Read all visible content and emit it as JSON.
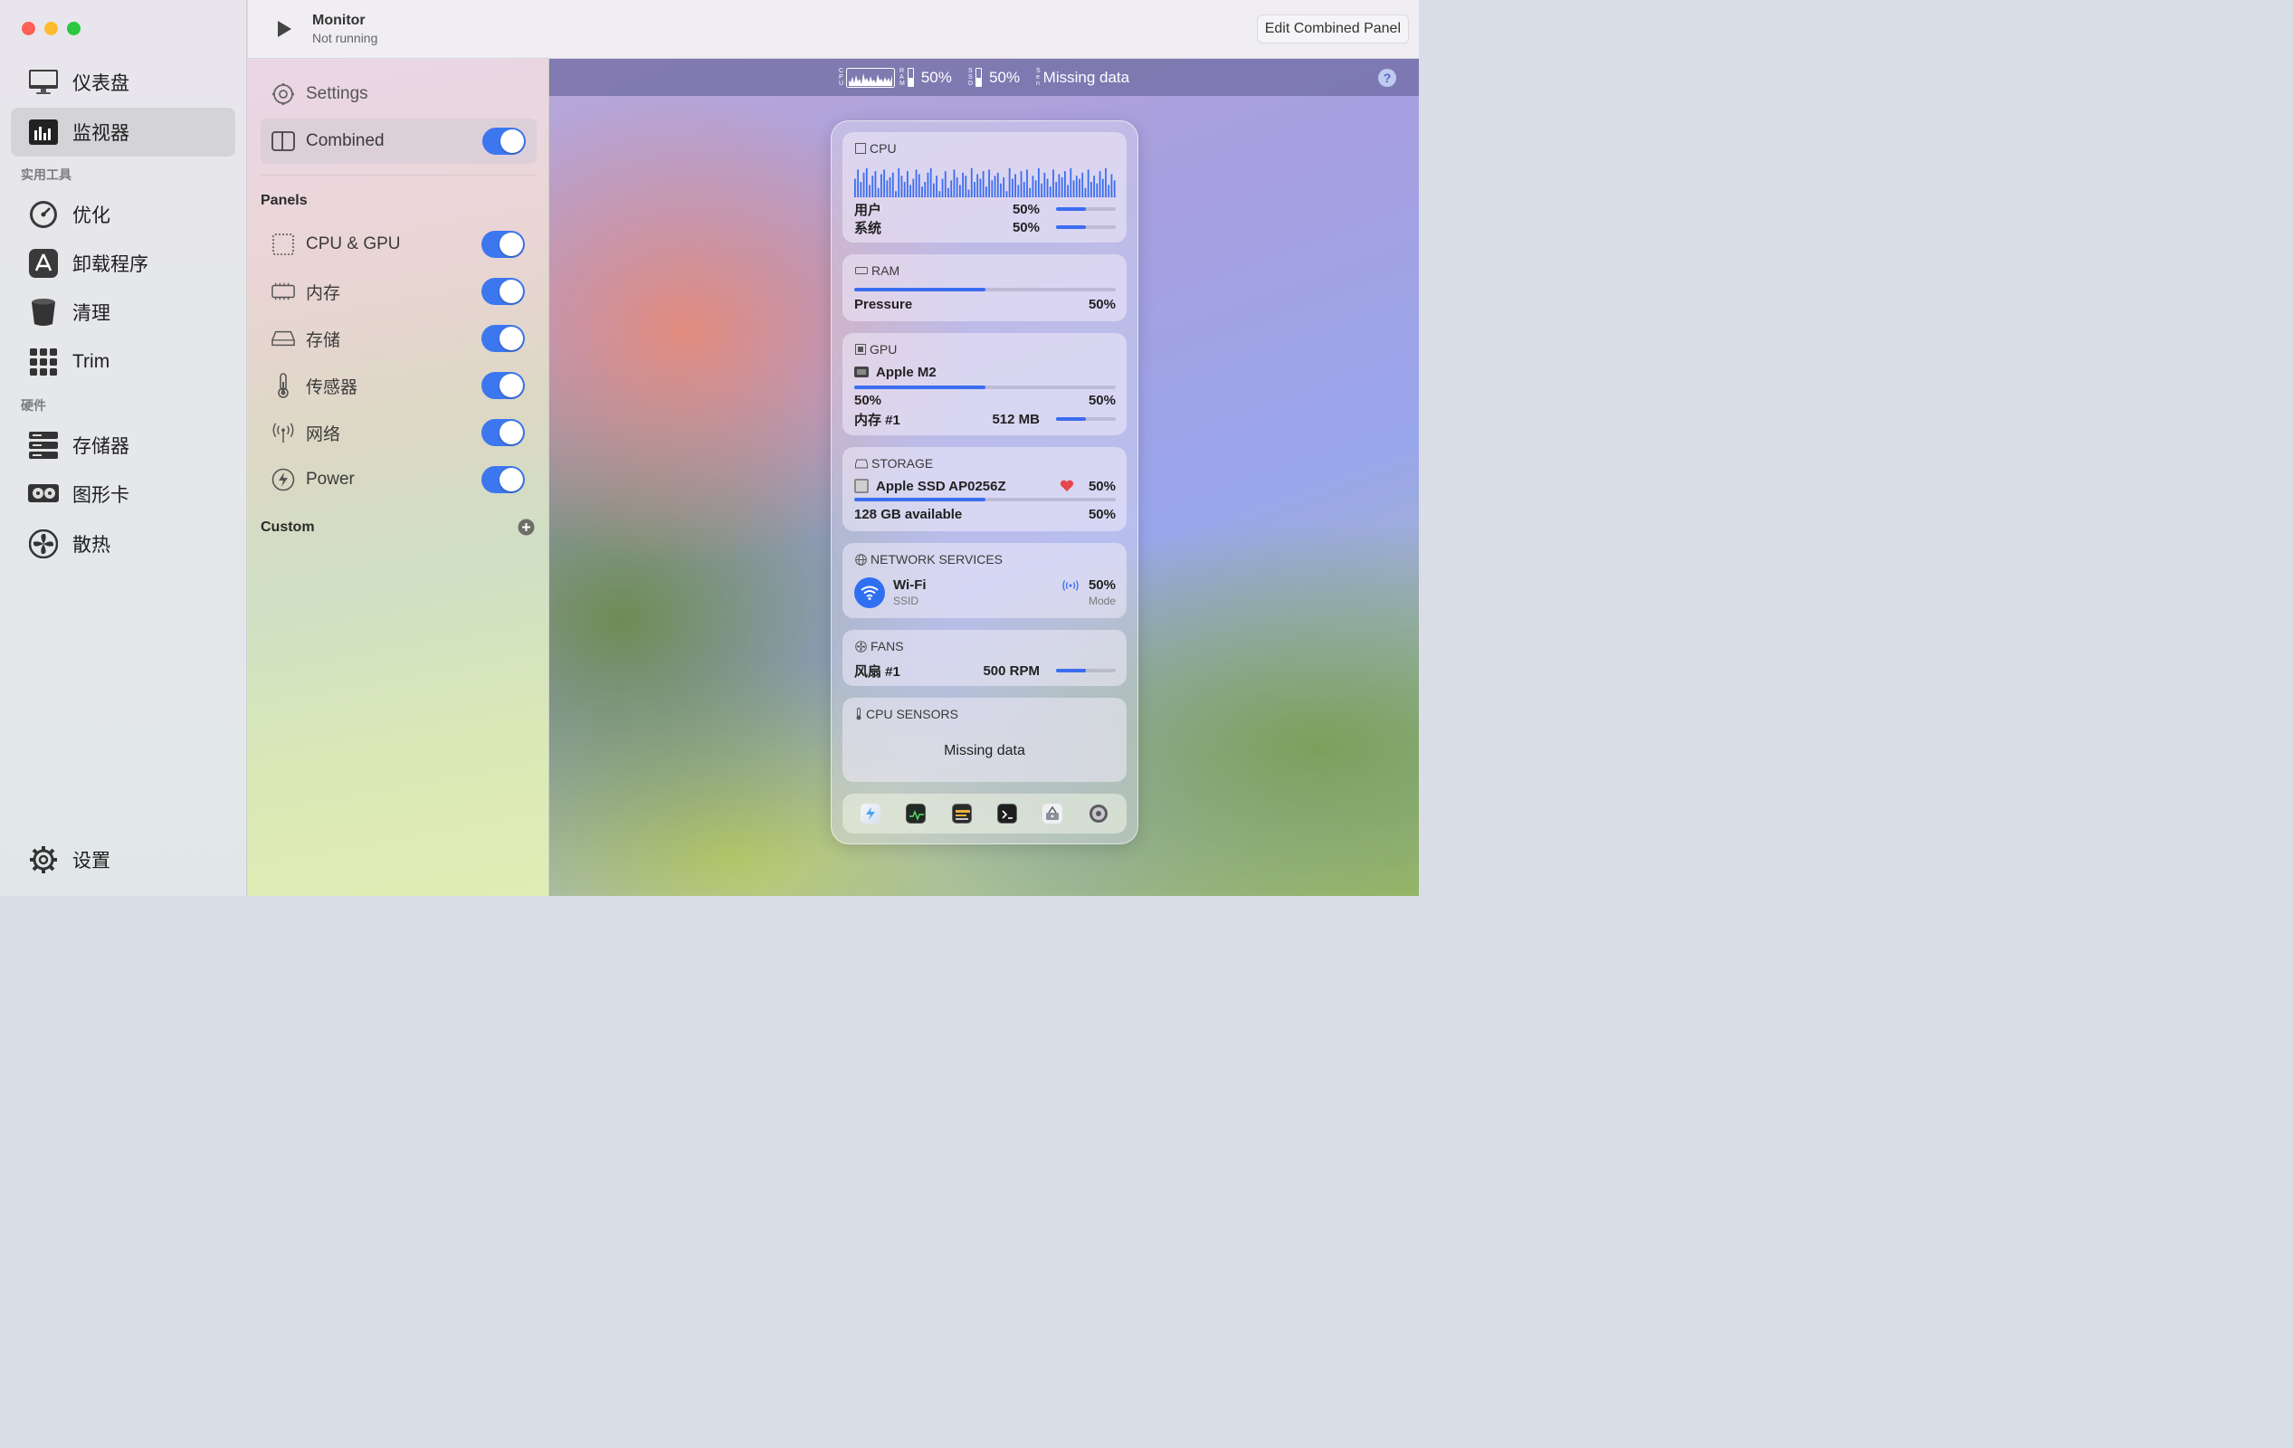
{
  "sidebar": {
    "items": [
      {
        "label": "仪表盘",
        "icon": "monitor-icon"
      },
      {
        "label": "监视器",
        "icon": "bar-chart-icon"
      },
      {
        "label": "优化",
        "icon": "gauge-icon"
      },
      {
        "label": "卸载程序",
        "icon": "app-store-icon"
      },
      {
        "label": "清理",
        "icon": "trash-bin-icon"
      },
      {
        "label": "Trim",
        "icon": "grid-icon"
      },
      {
        "label": "存储器",
        "icon": "server-icon"
      },
      {
        "label": "图形卡",
        "icon": "graphics-card-icon"
      },
      {
        "label": "散热",
        "icon": "fan-icon"
      },
      {
        "label": "设置",
        "icon": "gear-icon"
      }
    ],
    "sections": [
      "实用工具",
      "硬件"
    ]
  },
  "titlebar": {
    "title": "Monitor",
    "status": "Not running",
    "edit_button": "Edit Combined Panel"
  },
  "middle": {
    "settings_label": "Settings",
    "combined_label": "Combined",
    "panels_heading": "Panels",
    "panels": [
      "CPU & GPU",
      "内存",
      "存储",
      "传感器",
      "网络",
      "Power"
    ],
    "custom_heading": "Custom"
  },
  "menubar": {
    "cpu_letters": [
      "C",
      "P",
      "U"
    ],
    "ram_letters": [
      "R",
      "A",
      "M"
    ],
    "ssd_letters": [
      "S",
      "S",
      "D"
    ],
    "sen_letters": [
      "S",
      "e",
      "n"
    ],
    "ram_value": "50%",
    "ssd_value": "50%",
    "sensors_value": "Missing data",
    "help": "?"
  },
  "panel": {
    "cpu": {
      "title": "CPU",
      "user_label": "用户",
      "user_value": "50%",
      "system_label": "系统",
      "system_value": "50%",
      "user_fraction": 0.5,
      "system_fraction": 0.5,
      "history": [
        0.6,
        0.9,
        0.5,
        0.8,
        0.95,
        0.4,
        0.7,
        0.85,
        0.3,
        0.75,
        0.9,
        0.55,
        0.65,
        0.8,
        0.2,
        0.95,
        0.7,
        0.5,
        0.85,
        0.4,
        0.6,
        0.9,
        0.75,
        0.35,
        0.5,
        0.8,
        0.95,
        0.45,
        0.7,
        0.2,
        0.6,
        0.85,
        0.3,
        0.55,
        0.9,
        0.65,
        0.4,
        0.8,
        0.7,
        0.25,
        0.95,
        0.5,
        0.75,
        0.6,
        0.85,
        0.35,
        0.9,
        0.55,
        0.7,
        0.8,
        0.45,
        0.65,
        0.2,
        0.95,
        0.6,
        0.75,
        0.4,
        0.85,
        0.5,
        0.9,
        0.3,
        0.7,
        0.55,
        0.95,
        0.45,
        0.8,
        0.6,
        0.35,
        0.9,
        0.5,
        0.75,
        0.65,
        0.85,
        0.4,
        0.95,
        0.55,
        0.7,
        0.6,
        0.8,
        0.3,
        0.9,
        0.5,
        0.7,
        0.45,
        0.85,
        0.6,
        0.95,
        0.4,
        0.75,
        0.55
      ]
    },
    "ram": {
      "title": "RAM",
      "pressure_label": "Pressure",
      "pressure_value": "50%",
      "fraction": 0.5
    },
    "gpu": {
      "title": "GPU",
      "name": "Apple M2",
      "util_left": "50%",
      "util_right": "50%",
      "mem_label": "内存 #1",
      "mem_value": "512 MB",
      "fraction": 0.5,
      "mem_fraction": 0.5
    },
    "storage": {
      "title": "STORAGE",
      "name": "Apple SSD AP0256Z",
      "health": "50%",
      "available": "128 GB available",
      "available_pct": "50%",
      "fraction": 0.5
    },
    "network": {
      "title": "NETWORK SERVICES",
      "name": "Wi-Fi",
      "ssid": "SSID",
      "value": "50%",
      "mode": "Mode"
    },
    "fans": {
      "title": "FANS",
      "label": "风扇 #1",
      "value": "500 RPM",
      "fraction": 0.5
    },
    "sensors": {
      "title": "CPU SENSORS",
      "message": "Missing data"
    },
    "dock": [
      "power-app-icon",
      "activity-monitor-icon",
      "console-icon",
      "terminal-icon",
      "disk-utility-icon",
      "system-info-icon"
    ]
  },
  "colors": {
    "accent": "#3d77f0",
    "bar_fill": "#3b6df0",
    "health_heart": "#e5484d"
  }
}
